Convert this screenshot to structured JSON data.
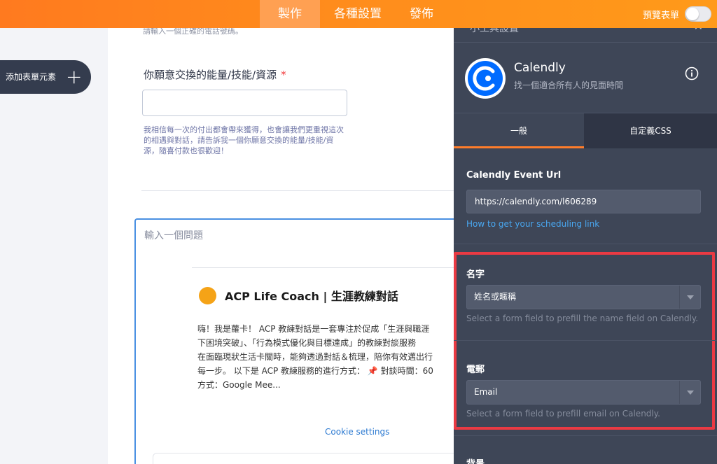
{
  "topbar": {
    "tabs": [
      {
        "label": "製作",
        "active": true
      },
      {
        "label": "各種設置",
        "active": false
      },
      {
        "label": "發佈",
        "active": false
      }
    ],
    "preview_label": "預覽表單",
    "preview_on": false,
    "accent": "#ff8a1c"
  },
  "left": {
    "add_element_label": "添加表單元素",
    "add_icon": "plus-icon"
  },
  "form": {
    "cut_off_text": "請輸入一個正確的電話號碼。",
    "question_label": "你願意交換的能量/技能/資源",
    "required_mark": "*",
    "answer_value": "",
    "sublabel": "我相信每一次的付出都會帶來獲得，也會讓我們更重視這次的相遇與對話，請告訴我一個你願意交換的能量/技能/資源，隨喜付款也很歡迎！",
    "selected_placeholder": "輸入一個問題",
    "embed": {
      "title": "ACP Life Coach | 生涯教練對話",
      "description": "嗨！我是蘿卡！ ACP 教練對話是一套專注於促成「生涯與職涯\n下困境突破」、「行為模式優化與目標達成」的教練對談服務\n在面臨現狀生活卡關時，能夠透過對話＆梳理，陪你有效邁出行\n每一步。 以下是 ACP 教練服務的進行方式： 📌 對談時間：60\n方式：Google Mee...",
      "cookie_label": "Cookie settings"
    }
  },
  "panel": {
    "header_cut": "小工具設置",
    "close_icon": "close-icon",
    "app": {
      "name": "Calendly",
      "description": "找一個適合所有人的見面時間",
      "logo_icon": "calendly-logo-icon",
      "info_icon": "info-icon"
    },
    "tabs": [
      {
        "label": "一般",
        "active": true
      },
      {
        "label": "自定義CSS",
        "active": false
      }
    ],
    "event_url": {
      "label": "Calendly Event Url",
      "value": "https://calendly.com/l606289",
      "help_link": "How to get your scheduling link"
    },
    "name_field": {
      "label": "名字",
      "selected": "姓名或暱稱",
      "hint": "Select a form field to prefill the name field on Calendly."
    },
    "email_field": {
      "label": "電郵",
      "selected": "Email",
      "hint": "Select a form field to prefill email on Calendly."
    },
    "background_label": "背景",
    "highlight_color": "#ea3a43",
    "link_color": "#49a7f0"
  }
}
